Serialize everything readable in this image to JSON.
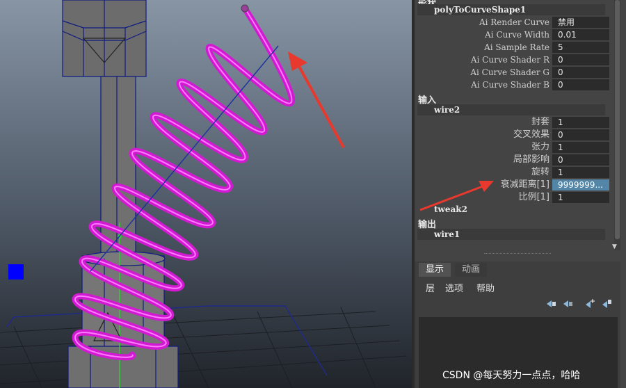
{
  "attribute_editor": {
    "top_section_label": "形状",
    "shape_node": "polyToCurveShape1",
    "shape_attributes": [
      {
        "label": "Ai Render Curve",
        "value": "禁用"
      },
      {
        "label": "Ai Curve Width",
        "value": "0.01"
      },
      {
        "label": "Ai Sample Rate",
        "value": "5"
      },
      {
        "label": "Ai Curve Shader R",
        "value": "0"
      },
      {
        "label": "Ai Curve Shader G",
        "value": "0"
      },
      {
        "label": "Ai Curve Shader B",
        "value": "0"
      }
    ],
    "inputs_label": "输入",
    "wire_node": "wire2",
    "wire_attributes": [
      {
        "label": "封套",
        "value": "1"
      },
      {
        "label": "交叉效果",
        "value": "0"
      },
      {
        "label": "张力",
        "value": "1"
      },
      {
        "label": "局部影响",
        "value": "0"
      },
      {
        "label": "旋转",
        "value": "1"
      },
      {
        "label": "衰减距离[1]",
        "value": "9999999...",
        "selected": true
      },
      {
        "label": "比例[1]",
        "value": "1"
      }
    ],
    "tweak_node": "tweak2",
    "outputs_label": "输出",
    "output_node": "wire1"
  },
  "layer_panel": {
    "tabs": [
      "显示",
      "动画"
    ],
    "active_tab": "显示",
    "menu": [
      "层",
      "选项",
      "帮助"
    ],
    "icons": [
      "move-layer-up-icon",
      "move-layer-down-icon",
      "create-layer-icon",
      "create-layer-from-selection-icon"
    ]
  },
  "viewport": {
    "description": "Maya perspective view: magenta wire helix around a gray cylinder with red annotation arrows"
  },
  "colors": {
    "helix": "#e020e0",
    "annotation_arrow": "#e8392e",
    "selected_field": "#5285a6",
    "manipulator": "#0000ff"
  },
  "watermark": "CSDN @每天努力一点点，哈哈"
}
